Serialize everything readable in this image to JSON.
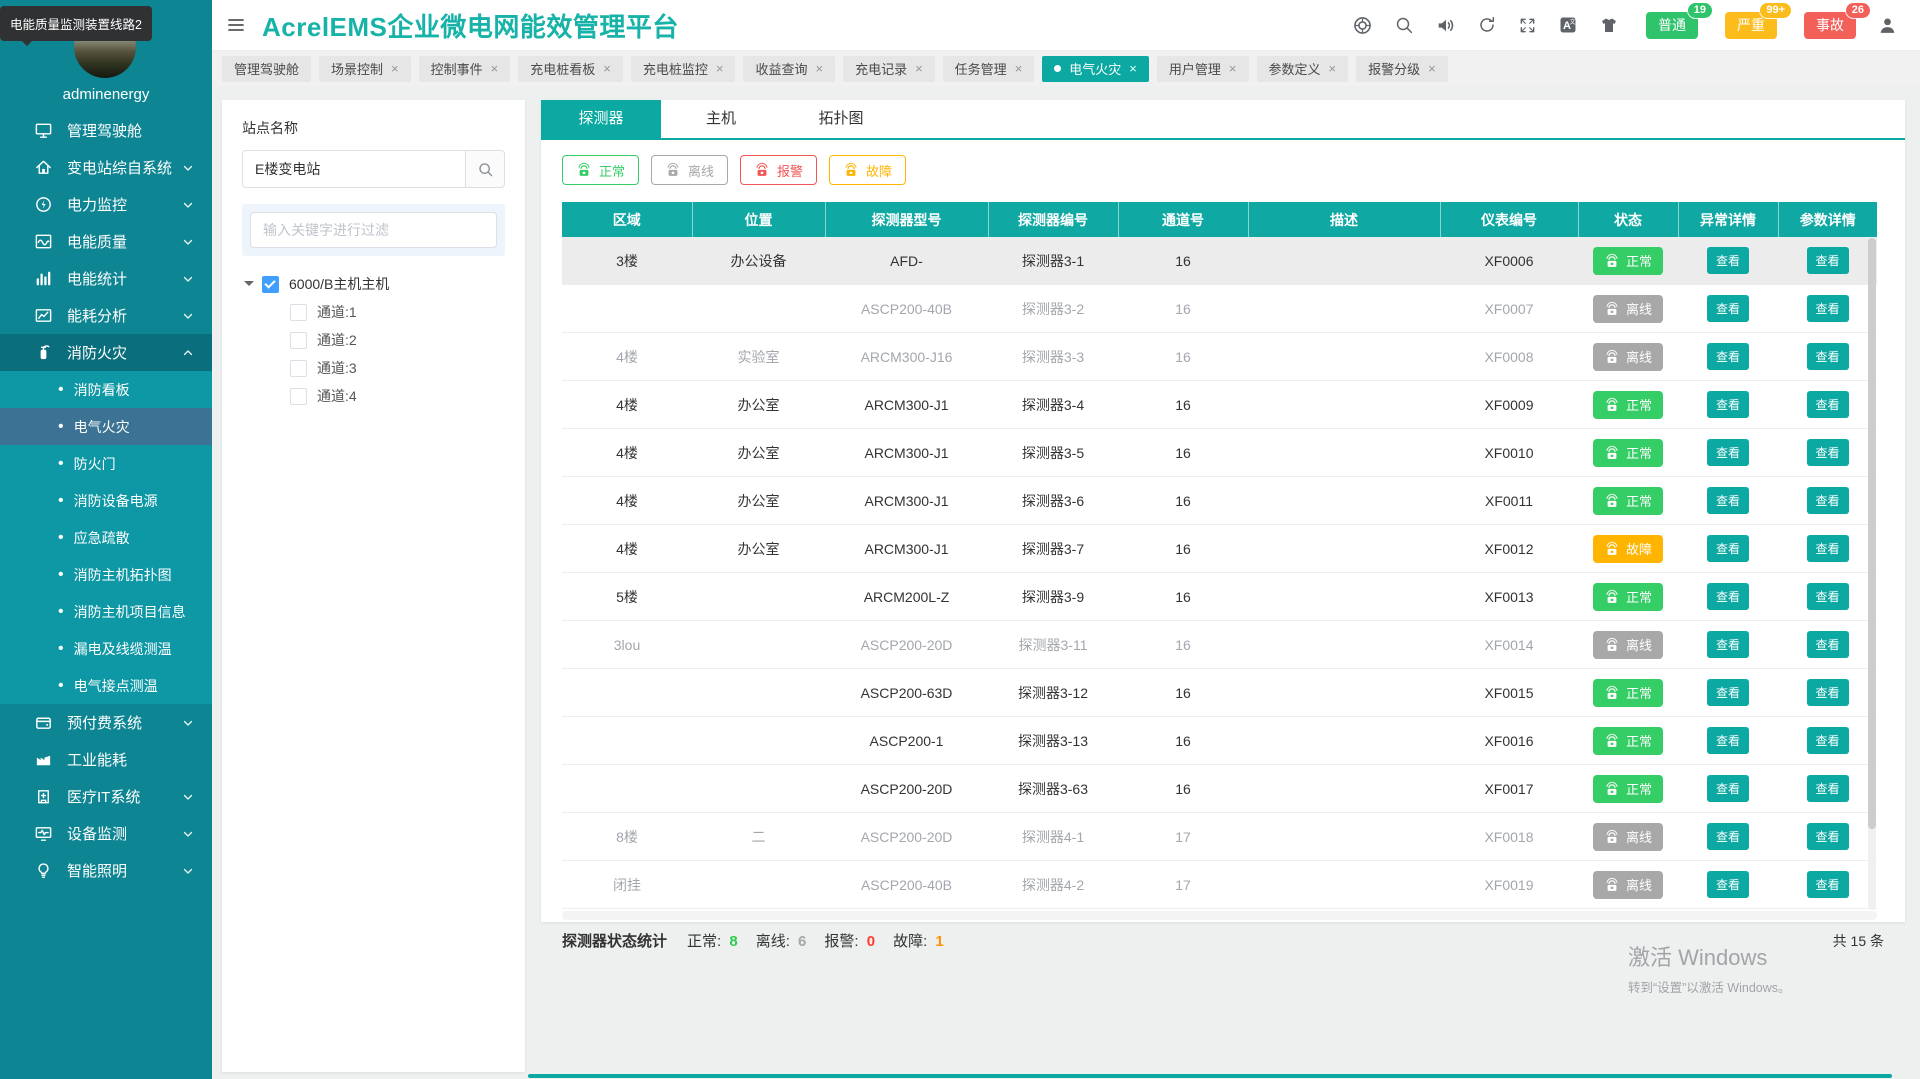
{
  "tooltip": "电能质量监测装置线路2",
  "sidebar": {
    "username": "adminenergy",
    "menu": [
      {
        "label": "管理驾驶舱",
        "icon": "dashboard-icon"
      },
      {
        "label": "变电站综自系统",
        "icon": "substation-home-icon",
        "chevron": "down"
      },
      {
        "label": "电力监控",
        "icon": "power-bolt-icon",
        "chevron": "down"
      },
      {
        "label": "电能质量",
        "icon": "wave-chart-icon",
        "chevron": "down"
      },
      {
        "label": "电能统计",
        "icon": "bar-chart-icon",
        "chevron": "down"
      },
      {
        "label": "能耗分析",
        "icon": "line-chart-icon",
        "chevron": "down"
      },
      {
        "label": "消防火灾",
        "icon": "fire-extinguisher-icon",
        "chevron": "up",
        "open": true,
        "children": [
          {
            "label": "消防看板"
          },
          {
            "label": "电气火灾",
            "selected": true
          },
          {
            "label": "防火门"
          },
          {
            "label": "消防设备电源"
          },
          {
            "label": "应急疏散"
          },
          {
            "label": "消防主机拓扑图"
          },
          {
            "label": "消防主机项目信息"
          },
          {
            "label": "漏电及线缆测温"
          },
          {
            "label": "电气接点测温"
          }
        ]
      },
      {
        "label": "预付费系统",
        "icon": "wallet-icon",
        "chevron": "down"
      },
      {
        "label": "工业能耗",
        "icon": "factory-icon"
      },
      {
        "label": "医疗IT系统",
        "icon": "hospital-icon",
        "chevron": "down"
      },
      {
        "label": "设备监测",
        "icon": "device-monitor-icon",
        "chevron": "down"
      },
      {
        "label": "智能照明",
        "icon": "bulb-icon",
        "chevron": "down"
      }
    ]
  },
  "header": {
    "title": "AcrelEMS企业微电网能效管理平台",
    "icons": [
      "help-ring-icon",
      "search-icon",
      "volume-icon",
      "refresh-icon",
      "fullscreen-icon",
      "translate-icon",
      "theme-shirt-icon"
    ],
    "alarms": [
      {
        "label": "普通",
        "count": "19",
        "color": "#2fc36b"
      },
      {
        "label": "严重",
        "count": "99+",
        "color": "#fbbc1c"
      },
      {
        "label": "事故",
        "count": "26",
        "color": "#f3605a"
      }
    ]
  },
  "tabs": [
    {
      "label": "管理驾驶舱",
      "closable": false
    },
    {
      "label": "场景控制",
      "closable": true
    },
    {
      "label": "控制事件",
      "closable": true
    },
    {
      "label": "充电桩看板",
      "closable": true
    },
    {
      "label": "充电桩监控",
      "closable": true
    },
    {
      "label": "收益查询",
      "closable": true
    },
    {
      "label": "充电记录",
      "closable": true
    },
    {
      "label": "任务管理",
      "closable": true
    },
    {
      "label": "电气火灾",
      "closable": true,
      "active": true
    },
    {
      "label": "用户管理",
      "closable": true
    },
    {
      "label": "参数定义",
      "closable": true
    },
    {
      "label": "报警分级",
      "closable": true
    }
  ],
  "site_panel": {
    "label": "站点名称",
    "search_value": "E楼变电站",
    "filter_placeholder": "输入关键字进行过滤",
    "tree": {
      "root": "6000/B主机主机",
      "root_checked": true,
      "children": [
        "通道:1",
        "通道:2",
        "通道:3",
        "通道:4"
      ]
    }
  },
  "content_tabs": [
    {
      "label": "探测器",
      "active": true
    },
    {
      "label": "主机"
    },
    {
      "label": "拓扑图"
    }
  ],
  "filters": [
    {
      "type": "normal"
    },
    {
      "type": "offline"
    },
    {
      "type": "alarm"
    },
    {
      "type": "fault"
    }
  ],
  "table": {
    "columns": [
      "区域",
      "位置",
      "探测器型号",
      "探测器编号",
      "通道号",
      "描述",
      "仪表编号",
      "状态",
      "异常详情",
      "参数详情"
    ],
    "view_label": "查看",
    "status_styles": {
      "normal": {
        "label": "正常",
        "color": "#35cd66"
      },
      "offline": {
        "label": "离线",
        "color": "#a8a8a8"
      },
      "alarm": {
        "label": "报警",
        "color": "#f25555"
      },
      "fault": {
        "label": "故障",
        "color": "#ffb400"
      }
    },
    "rows": [
      {
        "area": "3楼",
        "location": "办公设备",
        "model": "AFD-",
        "code": "探测器3-1",
        "channel": "16",
        "desc": "",
        "meter": "XF0006",
        "status": "normal",
        "highlight": true
      },
      {
        "area": "",
        "location": "",
        "model": "ASCP200-40B",
        "code": "探测器3-2",
        "channel": "16",
        "desc": "",
        "meter": "XF0007",
        "status": "offline"
      },
      {
        "area": "4楼",
        "location": "实验室",
        "model": "ARCM300-J16",
        "code": "探测器3-3",
        "channel": "16",
        "desc": "",
        "meter": "XF0008",
        "status": "offline"
      },
      {
        "area": "4楼",
        "location": "办公室",
        "model": "ARCM300-J1",
        "code": "探测器3-4",
        "channel": "16",
        "desc": "",
        "meter": "XF0009",
        "status": "normal"
      },
      {
        "area": "4楼",
        "location": "办公室",
        "model": "ARCM300-J1",
        "code": "探测器3-5",
        "channel": "16",
        "desc": "",
        "meter": "XF0010",
        "status": "normal"
      },
      {
        "area": "4楼",
        "location": "办公室",
        "model": "ARCM300-J1",
        "code": "探测器3-6",
        "channel": "16",
        "desc": "",
        "meter": "XF0011",
        "status": "normal"
      },
      {
        "area": "4楼",
        "location": "办公室",
        "model": "ARCM300-J1",
        "code": "探测器3-7",
        "channel": "16",
        "desc": "",
        "meter": "XF0012",
        "status": "fault"
      },
      {
        "area": "5楼",
        "location": "",
        "model": "ARCM200L-Z",
        "code": "探测器3-9",
        "channel": "16",
        "desc": "",
        "meter": "XF0013",
        "status": "normal"
      },
      {
        "area": "3lou",
        "location": "",
        "model": "ASCP200-20D",
        "code": "探测器3-11",
        "channel": "16",
        "desc": "",
        "meter": "XF0014",
        "status": "offline"
      },
      {
        "area": "",
        "location": "",
        "model": "ASCP200-63D",
        "code": "探测器3-12",
        "channel": "16",
        "desc": "",
        "meter": "XF0015",
        "status": "normal"
      },
      {
        "area": "",
        "location": "",
        "model": "ASCP200-1",
        "code": "探测器3-13",
        "channel": "16",
        "desc": "",
        "meter": "XF0016",
        "status": "normal"
      },
      {
        "area": "",
        "location": "",
        "model": "ASCP200-20D",
        "code": "探测器3-63",
        "channel": "16",
        "desc": "",
        "meter": "XF0017",
        "status": "normal"
      },
      {
        "area": "8楼",
        "location": "二",
        "model": "ASCP200-20D",
        "code": "探测器4-1",
        "channel": "17",
        "desc": "",
        "meter": "XF0018",
        "status": "offline"
      },
      {
        "area": "闭挂",
        "location": "",
        "model": "ASCP200-40B",
        "code": "探测器4-2",
        "channel": "17",
        "desc": "",
        "meter": "XF0019",
        "status": "offline"
      }
    ]
  },
  "footer": {
    "stats_label": "探测器状态统计",
    "stats": [
      {
        "label": "正常",
        "value": "8",
        "color": "#2fcc4e"
      },
      {
        "label": "离线",
        "value": "6",
        "color": "#a6a6a6"
      },
      {
        "label": "报警",
        "value": "0",
        "color": "#ff3b30"
      },
      {
        "label": "故障",
        "value": "1",
        "color": "#ff8f00"
      }
    ],
    "total": "共 15 条"
  },
  "watermark": {
    "line1": "激活 Windows",
    "line2": "转到“设置”以激活 Windows。"
  },
  "colors": {
    "accent": "#0ca9a2",
    "sidebar": "#0e8593",
    "submenu": "#0e98a6",
    "selected_item": "#3c7293",
    "title": "#17b2a8"
  }
}
